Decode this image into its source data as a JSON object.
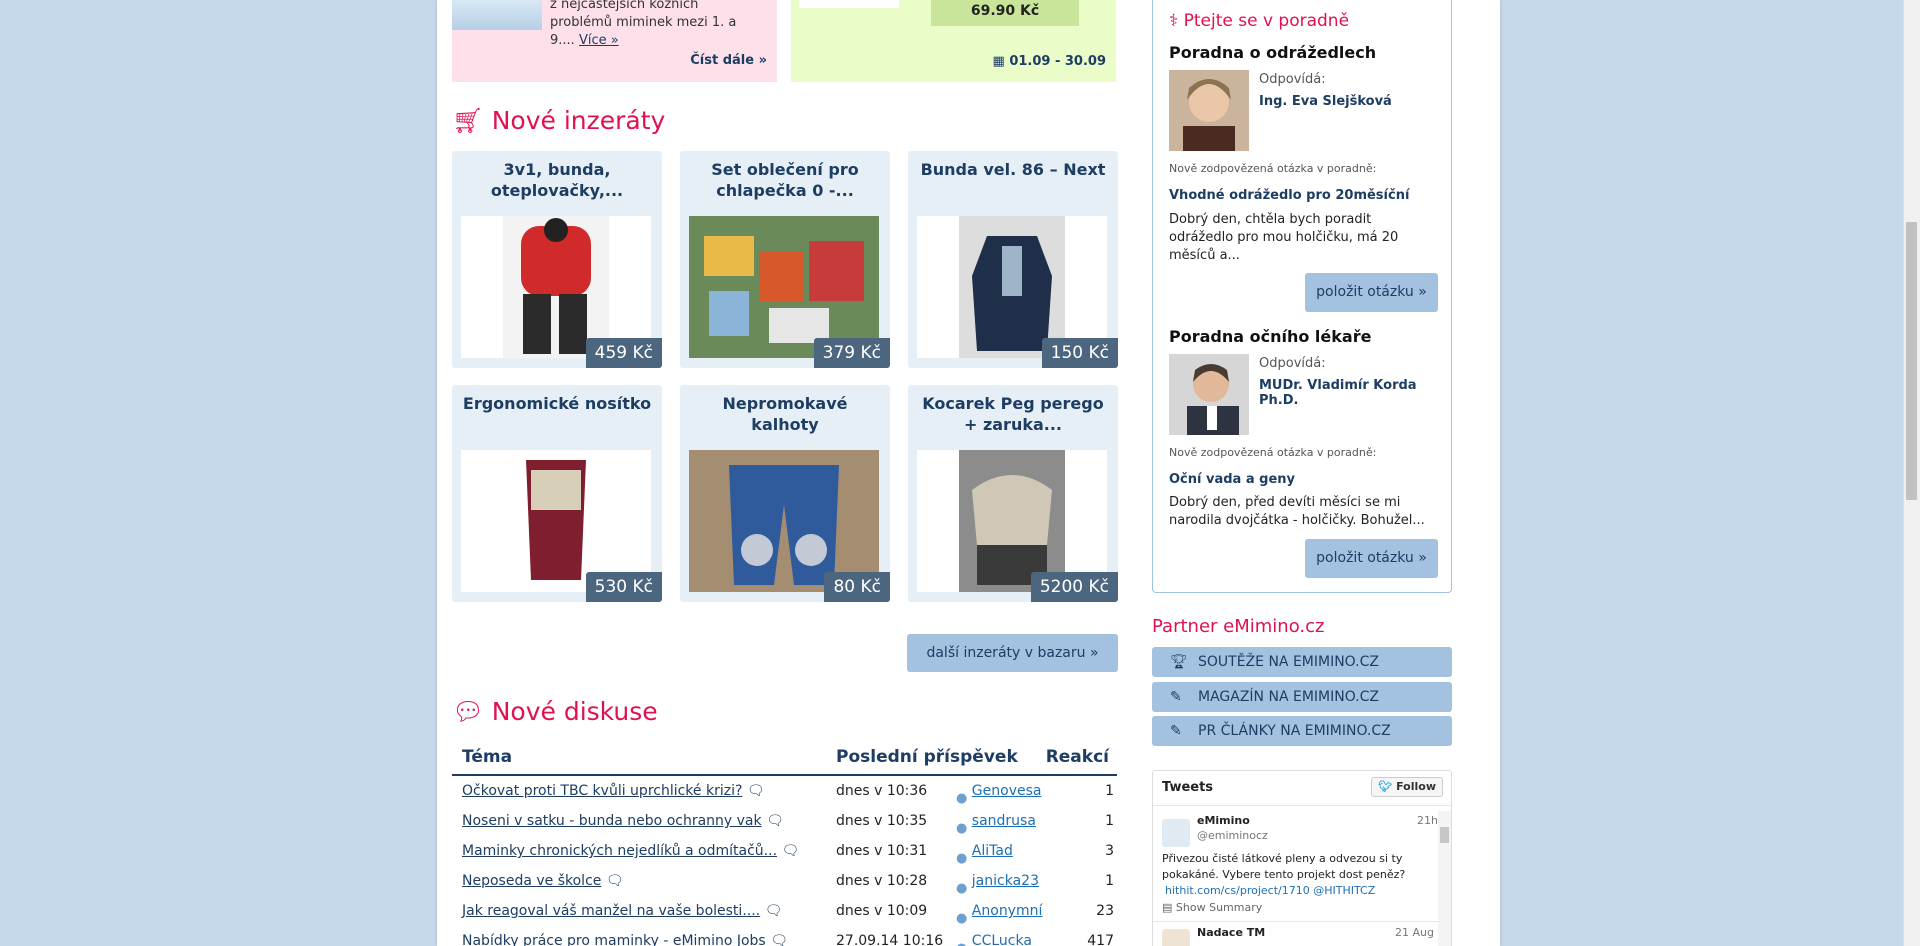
{
  "top": {
    "pink_text_line1": "z nejčastějších kožních",
    "pink_text_line2": "problémů miminek mezi 1. a",
    "pink_text_line3": "9.... ",
    "pink_more": "Více »",
    "pink_read_more": "Číst dále »",
    "green_price": "69.90 Kč",
    "green_dates": "01.09 - 30.09"
  },
  "ads": {
    "heading": "Nové inzeráty",
    "items": [
      {
        "title": "3v1, bunda, oteplovačky,...",
        "price": "459 Kč"
      },
      {
        "title": "Set oblečení pro chlapečka 0 -...",
        "price": "379 Kč"
      },
      {
        "title": "Bunda vel. 86 – Next",
        "price": "150 Kč"
      },
      {
        "title": "Ergonomické nosítko",
        "price": "530 Kč"
      },
      {
        "title": "Nepromokavé kalhoty",
        "price": "80 Kč"
      },
      {
        "title": "Kocarek Peg perego + zaruka...",
        "price": "5200 Kč"
      }
    ],
    "more_button": "další inzeráty v bazaru »"
  },
  "discussions": {
    "heading": "Nové diskuse",
    "col_topic": "Téma",
    "col_last": "Poslední příspěvek",
    "col_replies": "Reakcí",
    "rows": [
      {
        "topic": "Očkovat proti TBC kvůli uprchlické krizi?",
        "time": "dnes v 10:36",
        "user": "Genovesa",
        "replies": "1"
      },
      {
        "topic": "Noseni v satku - bunda nebo ochranny vak",
        "time": "dnes v 10:35",
        "user": "sandrusa",
        "replies": "1"
      },
      {
        "topic": "Maminky chronických nejedlíků a odmítačů...",
        "time": "dnes v 10:31",
        "user": "AliTad",
        "replies": "3"
      },
      {
        "topic": "Neposeda ve školce",
        "time": "dnes v 10:28",
        "user": "janicka23",
        "replies": "1"
      },
      {
        "topic": "Jak reagoval váš manžel na vaše bolesti....",
        "time": "dnes v 10:09",
        "user": "Anonymní",
        "replies": "23"
      },
      {
        "topic": "Nabídky práce pro maminky - eMimino Jobs",
        "time": "27.09.14 10:16",
        "user": "CCLucka",
        "replies": "417"
      }
    ]
  },
  "advice": {
    "heading": "Ptejte se v poradně",
    "sections": [
      {
        "title": "Poradna o odrážedlech",
        "answers_label": "Odpovídá:",
        "expert": "Ing. Eva Slejšková",
        "new_label": "Nově zodpovězená otázka v poradně:",
        "question": "Vhodné odrážedlo pro 20měsíční",
        "excerpt": "Dobrý den, chtěla bych poradit odrážedlo pro mou holčičku, má 20 měsíců a...",
        "button": "položit otázku »"
      },
      {
        "title": "Poradna očního lékaře",
        "answers_label": "Odpovídá:",
        "expert": "MUDr. Vladimír Korda Ph.D.",
        "new_label": "Nově zodpovězená otázka v poradně:",
        "question": "Oční vada a geny",
        "excerpt": "Dobrý den, před devíti měsíci se mi narodila dvojčátka - holčičky. Bohužel...",
        "button": "položit otázku »"
      }
    ]
  },
  "partner": {
    "heading": "Partner eMimino.cz",
    "links": [
      {
        "icon": "trophy-icon",
        "label": "SOUTĚŽE NA EMIMINO.CZ"
      },
      {
        "icon": "pencil-icon",
        "label": "MAGAZÍN NA EMIMINO.CZ"
      },
      {
        "icon": "pencil-icon",
        "label": "PR ČLÁNKY NA EMIMINO.CZ"
      }
    ]
  },
  "tweets": {
    "title": "Tweets",
    "follow": "Follow",
    "items": [
      {
        "name": "eMimino",
        "handle": "@emiminocz",
        "age": "21h",
        "text": "Přivezou čisté látkové pleny a odvezou si ty pokakáné. Vybere tento projekt dost peněz?",
        "link": "hithit.com/cs/project/1710 @HITHITCZ",
        "summary": "Show Summary"
      },
      {
        "name": "Nadace TM",
        "age": "21 Aug"
      }
    ]
  },
  "colors": {
    "accent": "#e0114f",
    "navy": "#1d3d63",
    "button": "#a3c2e0"
  }
}
